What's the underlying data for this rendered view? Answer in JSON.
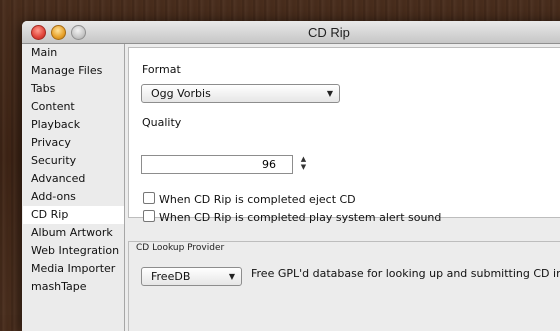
{
  "window": {
    "title": "CD Rip"
  },
  "sidebar": {
    "items": [
      {
        "label": "Main"
      },
      {
        "label": "Manage Files"
      },
      {
        "label": "Tabs"
      },
      {
        "label": "Content"
      },
      {
        "label": "Playback"
      },
      {
        "label": "Privacy"
      },
      {
        "label": "Security"
      },
      {
        "label": "Advanced"
      },
      {
        "label": "Add-ons"
      },
      {
        "label": "CD Rip"
      },
      {
        "label": "Album Artwork"
      },
      {
        "label": "Web Integration"
      },
      {
        "label": "Media Importer"
      },
      {
        "label": "mashTape"
      }
    ],
    "selected": "CD Rip"
  },
  "rip": {
    "format_label": "Format",
    "format_value": "Ogg Vorbis",
    "quality_label": "Quality",
    "quality_value": "96",
    "checkbox1_label": "When CD Rip is completed eject CD",
    "checkbox1_checked": false,
    "checkbox2_label": "When CD Rip is completed play system alert sound",
    "checkbox2_checked": false
  },
  "lookup": {
    "group_label": "CD Lookup Provider",
    "provider_value": "FreeDB",
    "provider_description": "Free GPL'd database for looking up and submitting CD info"
  }
}
